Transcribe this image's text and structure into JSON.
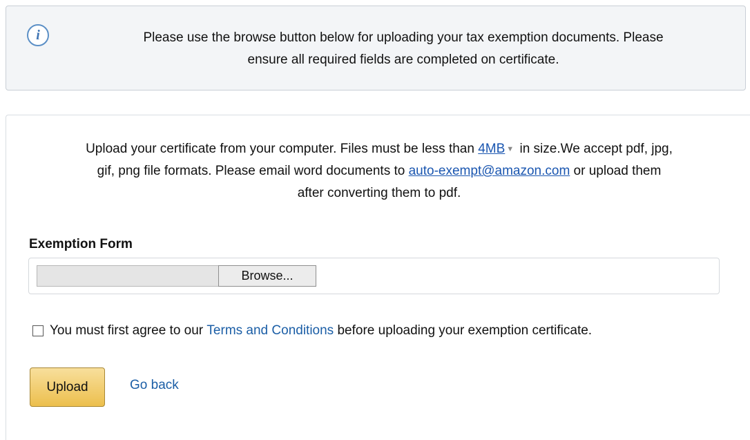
{
  "info": {
    "icon": "info-icon",
    "icon_glyph": "i",
    "message_line1": "Please use the browse button below for uploading your tax exemption documents. Please",
    "message_line2": "ensure all required fields are completed on certificate."
  },
  "upload": {
    "desc_before_size": "Upload your certificate from your computer. Files must be less than ",
    "size_link": "4MB",
    "desc_after_size": " in size.We accept pdf, jpg,",
    "desc_line2_before_email": "gif, png file formats. Please email word documents to ",
    "email_link": "auto-exempt@amazon.com",
    "desc_line2_after_email": " or upload them",
    "desc_line3": "after converting them to pdf.",
    "form_label": "Exemption Form",
    "browse_label": "Browse..."
  },
  "terms": {
    "text_before_link": "You must first agree to our ",
    "link_label": "Terms and Conditions",
    "text_after_link": " before uploading your exemption certificate.",
    "checked": false
  },
  "actions": {
    "upload_label": "Upload",
    "go_back_label": "Go back"
  },
  "colors": {
    "link": "#1a56b0",
    "upload_button": "#ecbf4d",
    "info_background": "#f3f5f7"
  }
}
